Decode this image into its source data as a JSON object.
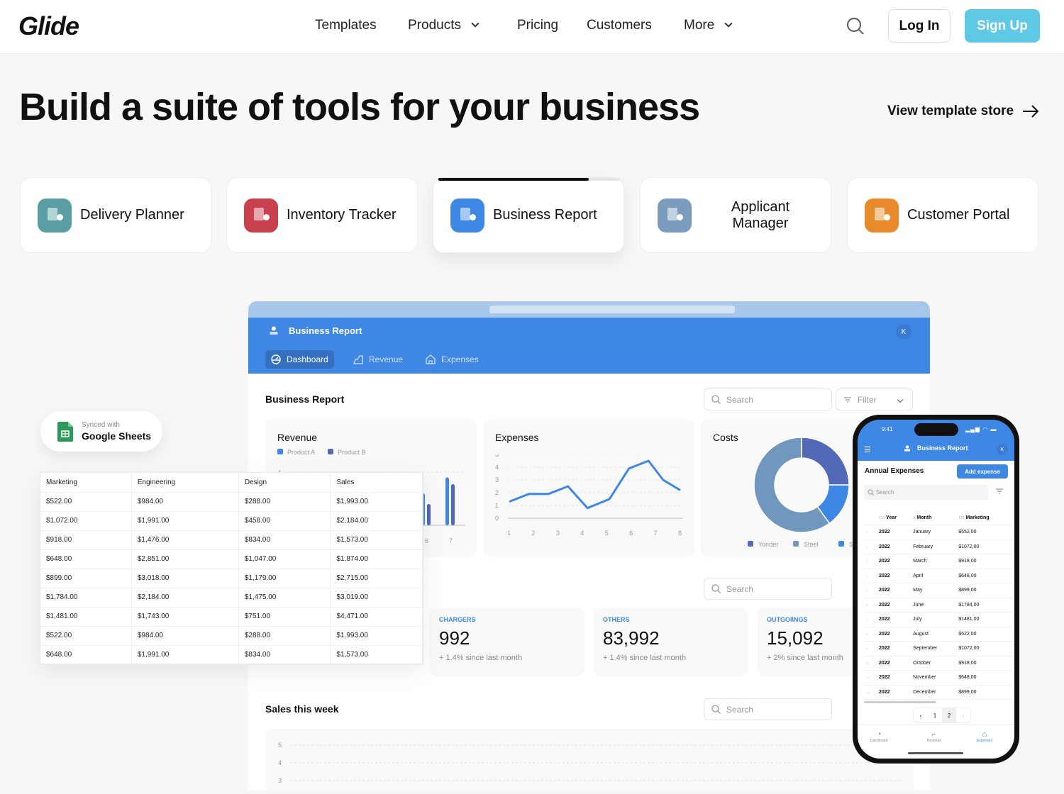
{
  "nav": {
    "logo": "Glide",
    "items": [
      "Templates",
      "Products",
      "Pricing",
      "Customers",
      "More"
    ],
    "login": "Log In",
    "signup": "Sign Up"
  },
  "hero": {
    "title": "Build a suite of tools for your business",
    "store_link": "View template store"
  },
  "templates": [
    {
      "label": "Delivery Planner",
      "color": "#5a9ea3"
    },
    {
      "label": "Inventory Tracker",
      "color": "#c9404e"
    },
    {
      "label": "Business Report",
      "color": "#3f87e5",
      "active": true,
      "progress": 0.83
    },
    {
      "label": "Applicant Manager",
      "color": "#7b9cbd"
    },
    {
      "label": "Customer Portal",
      "color": "#e88a2c"
    }
  ],
  "app": {
    "title": "Business Report",
    "avatar": "K",
    "tabs": [
      "Dashboard",
      "Revenue",
      "Expenses"
    ],
    "section_title": "Business Report",
    "search_placeholder": "Search",
    "filter_label": "Filter",
    "sales_title": "Sales this week"
  },
  "chart_data": [
    {
      "type": "bar",
      "title": "Revenue",
      "legend": [
        "Product A",
        "Product B"
      ],
      "x": [
        "6",
        "7"
      ],
      "series": [
        {
          "name": "Product A",
          "values": [
            2.4,
            3.6
          ]
        },
        {
          "name": "Product B",
          "values": [
            1.6,
            3.1
          ]
        }
      ],
      "ylim": [
        0,
        4
      ],
      "yticks": [
        "4"
      ],
      "colors": [
        "#3f87e5",
        "#5468b8"
      ]
    },
    {
      "type": "line",
      "title": "Expenses",
      "x": [
        1,
        1.8,
        2.6,
        3.4,
        4.2,
        5.1,
        5.9,
        6.7,
        7.3,
        8
      ],
      "y": [
        1.3,
        1.9,
        1.9,
        2.5,
        0.8,
        1.5,
        3.9,
        4.5,
        3.0,
        2.2
      ],
      "xticks": [
        "1",
        "2",
        "3",
        "4",
        "5",
        "6",
        "7",
        "8"
      ],
      "yticks": [
        "0",
        "1",
        "2",
        "3",
        "4",
        "5"
      ],
      "ylim": [
        0,
        5
      ],
      "color": "#3f87e5"
    },
    {
      "type": "pie",
      "title": "Costs",
      "labels": [
        "Yonder",
        "Sky",
        "Steel"
      ],
      "values": [
        25,
        15,
        60
      ],
      "colors": [
        "#5468b8",
        "#3f87e5",
        "#7097bd"
      ]
    },
    {
      "type": "line",
      "title": "Sales this week",
      "yticks": [
        "5",
        "4",
        "3"
      ]
    }
  ],
  "kpis": [
    {
      "label": "CHARGERS",
      "value": "992",
      "sub": "+ 1.4% since last month"
    },
    {
      "label": "OTHERS",
      "value": "83,992",
      "sub": "+ 1.4% since last month"
    },
    {
      "label": "OUTGOIINGS",
      "value": "15,092",
      "sub": "+ 2% since last month"
    }
  ],
  "sheets_badge": {
    "line1": "Synced with",
    "line2": "Google Sheets"
  },
  "sheet": {
    "columns": [
      "Marketing",
      "Engineering",
      "Design",
      "Sales"
    ],
    "rows": [
      [
        "$522.00",
        "$984.00",
        "$288.00",
        "$1,993.00"
      ],
      [
        "$1,072.00",
        "$1,991.00",
        "$458.00",
        "$2,184.00"
      ],
      [
        "$918.00",
        "$1,476.00",
        "$834.00",
        "$1,573.00"
      ],
      [
        "$648.00",
        "$2,851.00",
        "$1,047.00",
        "$1,874.00"
      ],
      [
        "$899.00",
        "$3,018.00",
        "$1,179.00",
        "$2,715.00"
      ],
      [
        "$1,784.00",
        "$2,184.00",
        "$1,475.00",
        "$3,019.00"
      ],
      [
        "$1,481.00",
        "$1,743.00",
        "$751.00",
        "$4,471.00"
      ],
      [
        "$522.00",
        "$984.00",
        "$288.00",
        "$1,993.00"
      ],
      [
        "$648.00",
        "$1,991.00",
        "$834.00",
        "$1,573.00"
      ]
    ]
  },
  "phone": {
    "time": "9:41",
    "title": "Business Report",
    "avatar": "K",
    "section": "Annual Expenses",
    "add_button": "Add expense",
    "search_placeholder": "Search",
    "columns": [
      "Year",
      "Month",
      "Marketing"
    ],
    "column_types": [
      "123",
      "A",
      "123"
    ],
    "rows": [
      [
        "2022",
        "January",
        "$552,00"
      ],
      [
        "2022",
        "February",
        "$1072,00"
      ],
      [
        "2022",
        "March",
        "$918,00"
      ],
      [
        "2022",
        "April",
        "$648,00"
      ],
      [
        "2022",
        "May",
        "$899,00"
      ],
      [
        "2022",
        "June",
        "$1784,00"
      ],
      [
        "2022",
        "July",
        "$1481,00"
      ],
      [
        "2022",
        "August",
        "$522,00"
      ],
      [
        "2022",
        "September",
        "$1072,00"
      ],
      [
        "2022",
        "October",
        "$918,00"
      ],
      [
        "2022",
        "November",
        "$648,00"
      ],
      [
        "2022",
        "December",
        "$899,00"
      ]
    ],
    "pages": [
      "1",
      "2"
    ],
    "current_page": "2",
    "tabs": [
      "Dashboard",
      "Revenue",
      "Expenses"
    ],
    "active_tab": "Expenses"
  }
}
